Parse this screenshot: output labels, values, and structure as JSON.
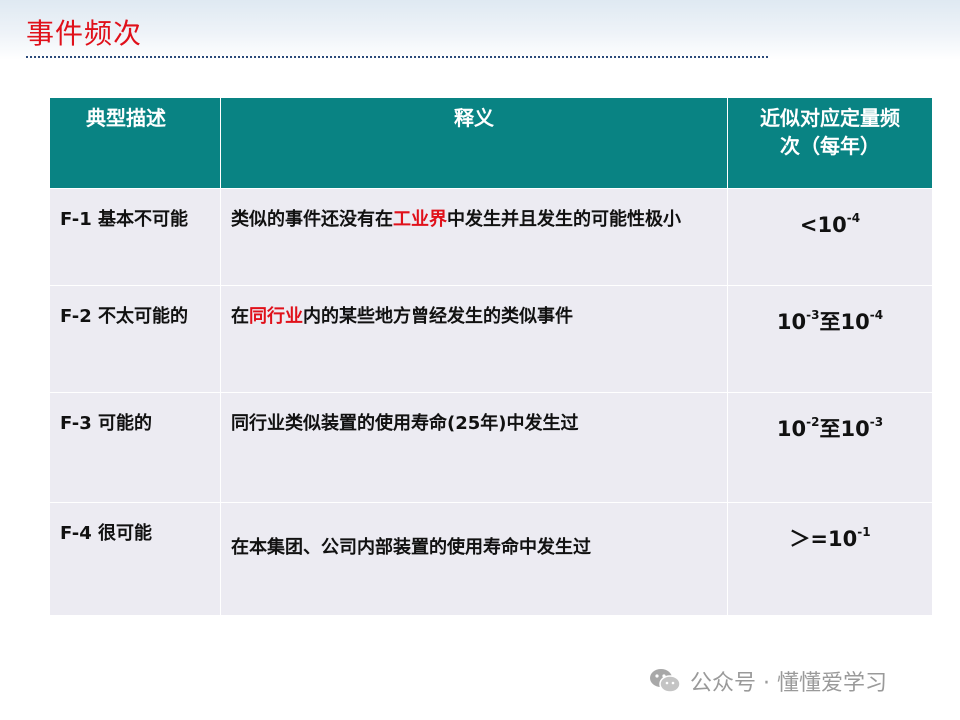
{
  "page": {
    "title": "事件频次"
  },
  "table": {
    "headers": {
      "col1": "典型描述",
      "col2": "释义",
      "col3_line1": "近似对应定量频",
      "col3_line2": "次（每年）"
    },
    "rows": [
      {
        "description": "F-1 基本不可能",
        "meaning_before": "类似的事件还没有在",
        "meaning_highlight": "工业界",
        "meaning_after": "中发生并且发生的可能性极小",
        "freq_base": "<10",
        "freq_exp": "-4",
        "freq_mid": "",
        "freq_base2": "",
        "freq_exp2": ""
      },
      {
        "description": "F-2 不太可能的",
        "meaning_before": "在",
        "meaning_highlight": "同行业",
        "meaning_after": "内的某些地方曾经发生的类似事件",
        "freq_base": "10",
        "freq_exp": "-3",
        "freq_mid": "至",
        "freq_base2": "10",
        "freq_exp2": "-4"
      },
      {
        "description": "F-3 可能的",
        "meaning_before": "同行业类似装置的使用寿命(25年)中发生过",
        "meaning_highlight": "",
        "meaning_after": "",
        "freq_base": "10",
        "freq_exp": "-2",
        "freq_mid": "至",
        "freq_base2": "10",
        "freq_exp2": "-3"
      },
      {
        "description": "F-4 很可能",
        "meaning_before": "在本集团、公司内部装置的使用寿命中发生过",
        "meaning_highlight": "",
        "meaning_after": "",
        "freq_base": "＞=10",
        "freq_exp": "-1",
        "freq_mid": "",
        "freq_base2": "",
        "freq_exp2": ""
      }
    ]
  },
  "footer": {
    "icon": "wechat-icon",
    "text": "公众号 · 懂懂爱学习"
  },
  "colors": {
    "title": "#e0101a",
    "header_bg": "#098383",
    "row_bg": "#ecebf2",
    "highlight": "#e0101a"
  }
}
